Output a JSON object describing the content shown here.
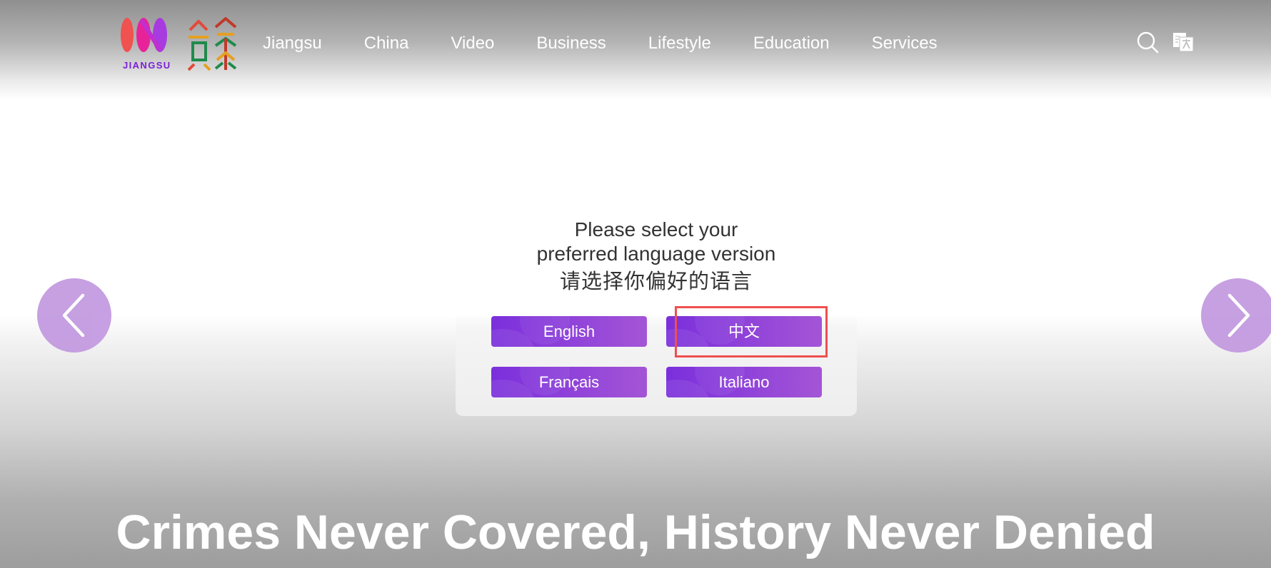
{
  "header": {
    "logo": {
      "brand_text": "JIANGSU",
      "icon": "in-jiangsu-logo",
      "chinese_mark_icon": "su-character-logo"
    },
    "nav": [
      {
        "label": "Jiangsu"
      },
      {
        "label": "China"
      },
      {
        "label": "Video"
      },
      {
        "label": "Business"
      },
      {
        "label": "Lifestyle"
      },
      {
        "label": "Education"
      },
      {
        "label": "Services"
      }
    ],
    "icons": [
      "search-icon",
      "language-switch-icon"
    ]
  },
  "carousel": {
    "prev_icon": "chevron-left-icon",
    "next_icon": "chevron-right-icon"
  },
  "language_modal": {
    "title_line1": "Please select your",
    "title_line2": "preferred language version",
    "title_cn": "请选择你偏好的语言",
    "options": [
      {
        "label": "English"
      },
      {
        "label": "中文"
      },
      {
        "label": "Français"
      },
      {
        "label": "Italiano"
      }
    ],
    "highlighted_option": "中文"
  },
  "hero": {
    "headline": "Crimes Never Covered, History Never Denied"
  },
  "colors": {
    "accent_purple": "#8a3fd8",
    "arrow_circle": "#c39be0",
    "highlight_box": "#ef4f4f",
    "logo_purple": "#7b1fd6"
  }
}
